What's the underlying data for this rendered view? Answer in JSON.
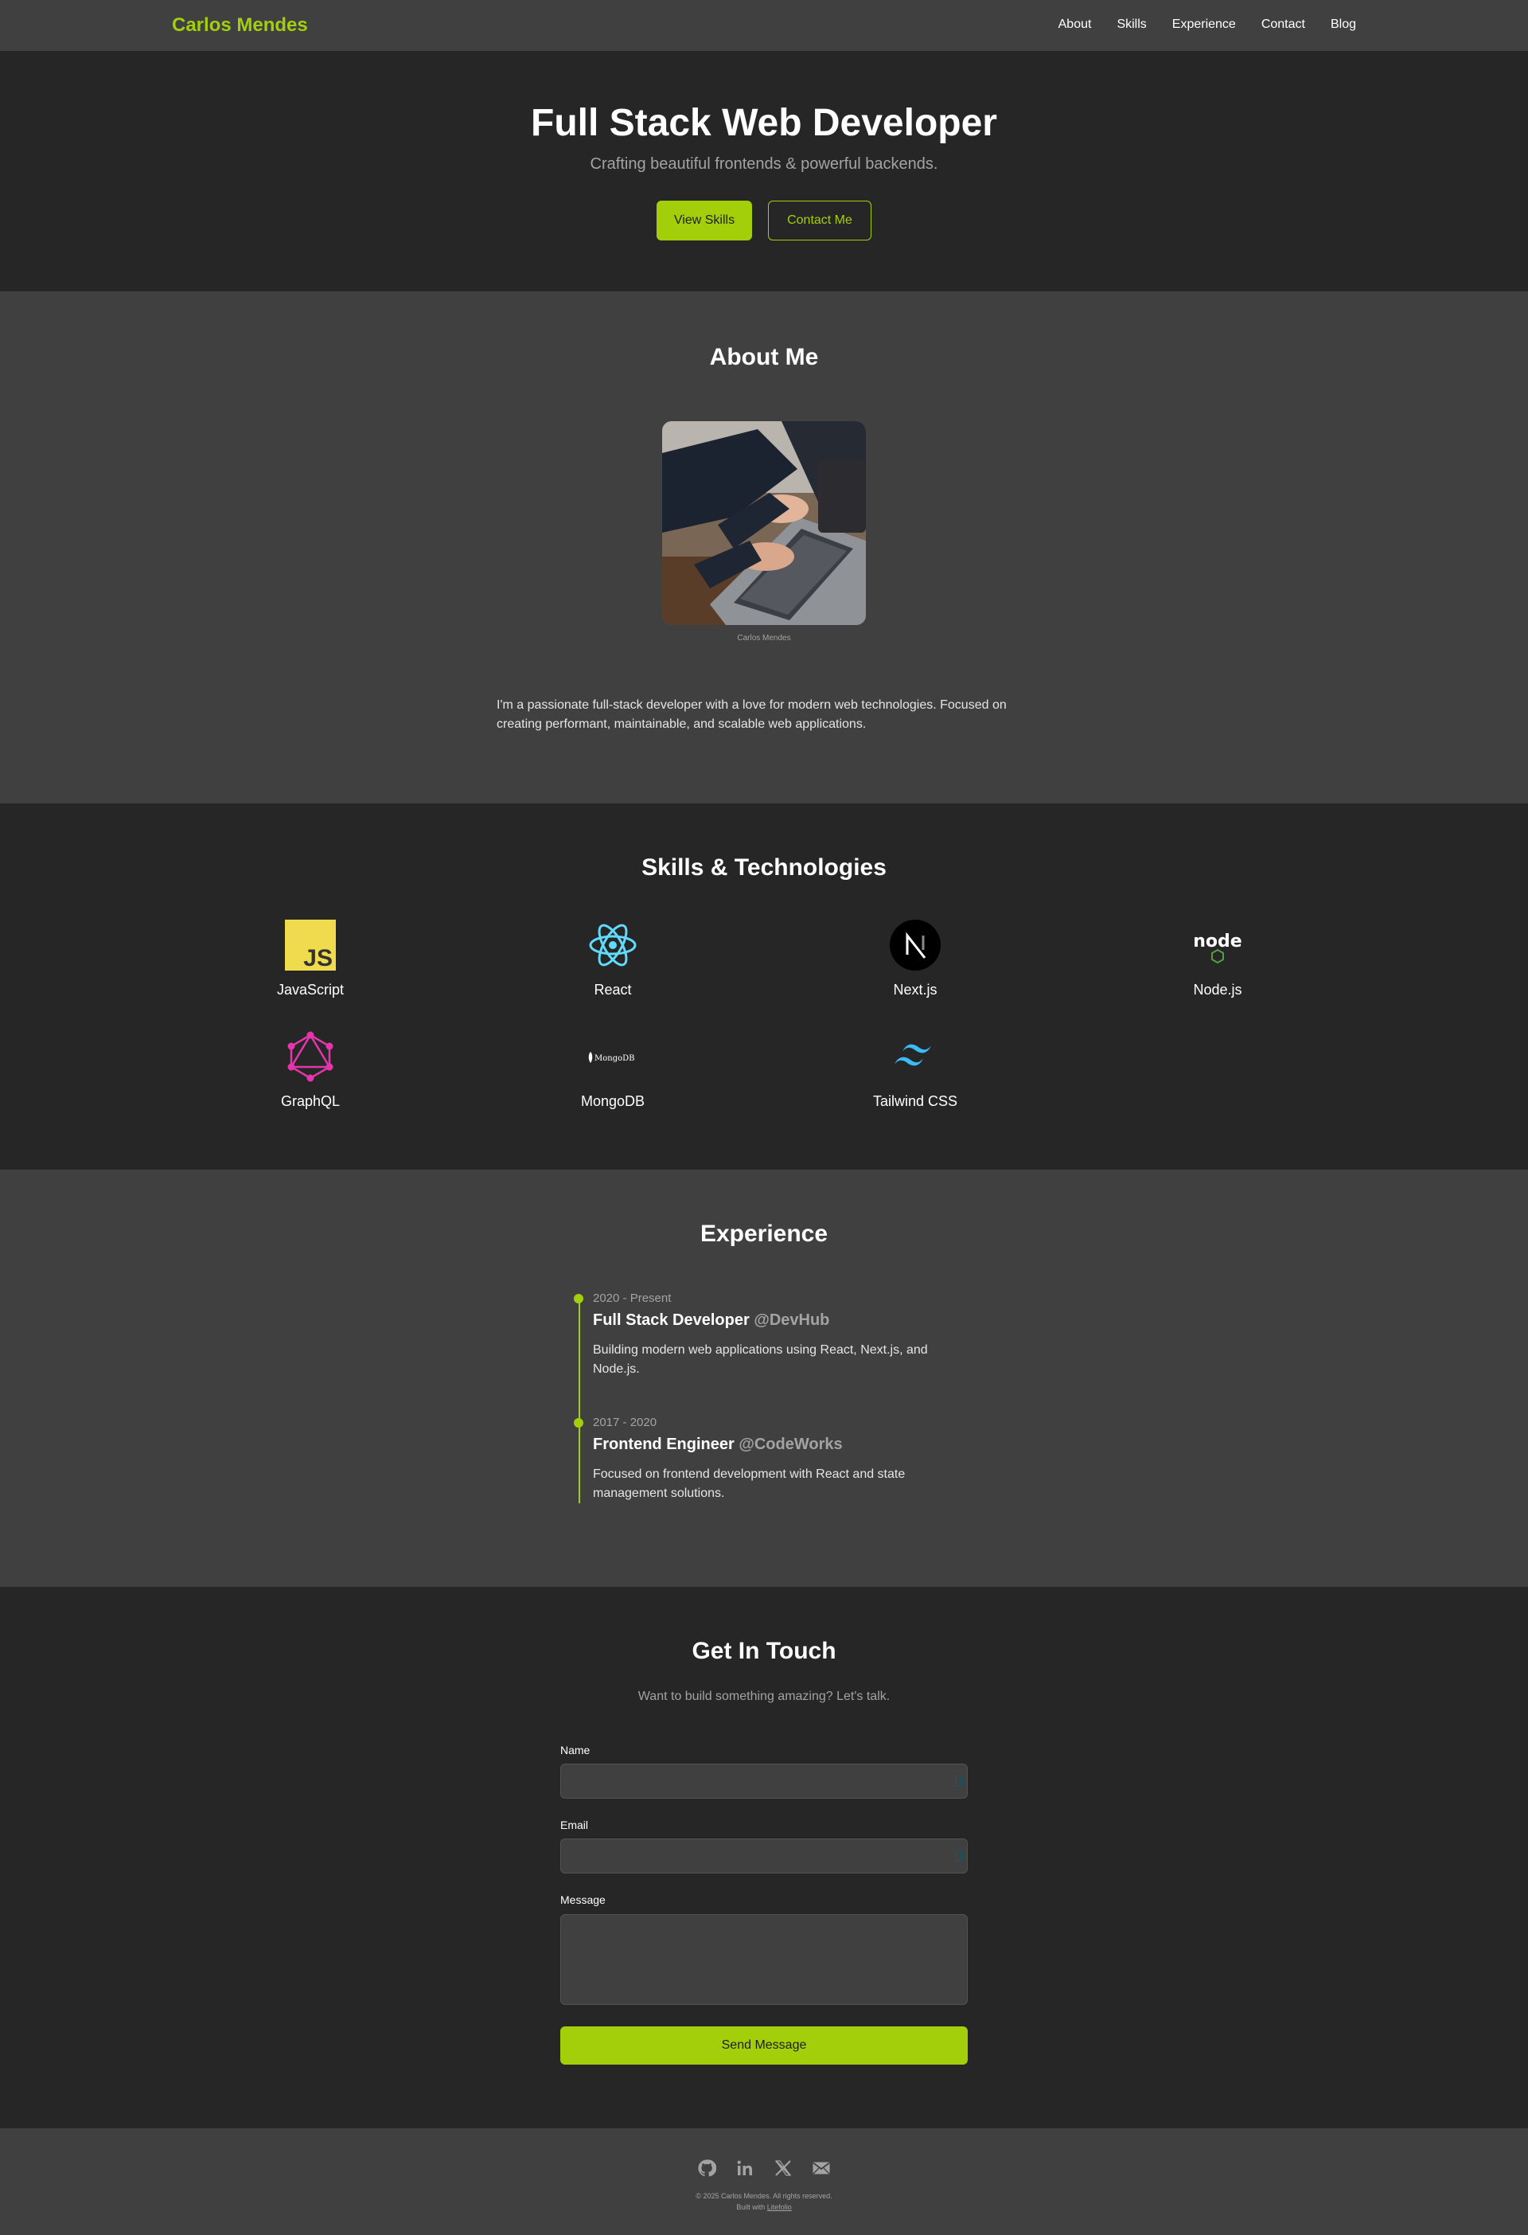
{
  "nav": {
    "logo": "Carlos Mendes",
    "links": [
      "About",
      "Skills",
      "Experience",
      "Contact",
      "Blog"
    ]
  },
  "hero": {
    "title": "Full Stack Web Developer",
    "subtitle": "Crafting beautiful frontends & powerful backends.",
    "primary_button": "View Skills",
    "secondary_button": "Contact Me"
  },
  "about": {
    "title": "About Me",
    "photo_caption": "Carlos Mendes",
    "text": "I'm a passionate full-stack developer with a love for modern web technologies. Focused on creating performant, maintainable, and scalable web applications."
  },
  "skills": {
    "title": "Skills & Technologies",
    "items": [
      {
        "label": "JavaScript",
        "icon": "javascript-icon"
      },
      {
        "label": "React",
        "icon": "react-icon"
      },
      {
        "label": "Next.js",
        "icon": "nextjs-icon"
      },
      {
        "label": "Node.js",
        "icon": "nodejs-icon"
      },
      {
        "label": "GraphQL",
        "icon": "graphql-icon"
      },
      {
        "label": "MongoDB",
        "icon": "mongodb-icon"
      },
      {
        "label": "Tailwind CSS",
        "icon": "tailwind-icon"
      }
    ],
    "js_glyph": "JS",
    "node_glyph": "node",
    "mongodb_wordmark": "MongoDB"
  },
  "experience": {
    "title": "Experience",
    "items": [
      {
        "date": "2020 - Present",
        "role": "Full Stack Developer",
        "company": "@DevHub",
        "description": "Building modern web applications using React, Next.js, and Node.js."
      },
      {
        "date": "2017 - 2020",
        "role": "Frontend Engineer",
        "company": "@CodeWorks",
        "description": "Focused on frontend development with React and state management solutions."
      }
    ]
  },
  "contact": {
    "title": "Get In Touch",
    "subtitle": "Want to build something amazing? Let's talk.",
    "name_label": "Name",
    "name_value": "",
    "email_label": "Email",
    "email_value": "",
    "message_label": "Message",
    "message_value": "",
    "submit": "Send Message"
  },
  "footer": {
    "socials": [
      "github-icon",
      "linkedin-icon",
      "x-icon",
      "mail-icon"
    ],
    "copyright": "© 2025 Carlos Mendes. All rights reserved.",
    "built_prefix": "Built with",
    "built_link": "Litefolio"
  },
  "colors": {
    "accent": "#a3cf0a",
    "dark_bg": "#262626",
    "section_bg": "#404040"
  }
}
